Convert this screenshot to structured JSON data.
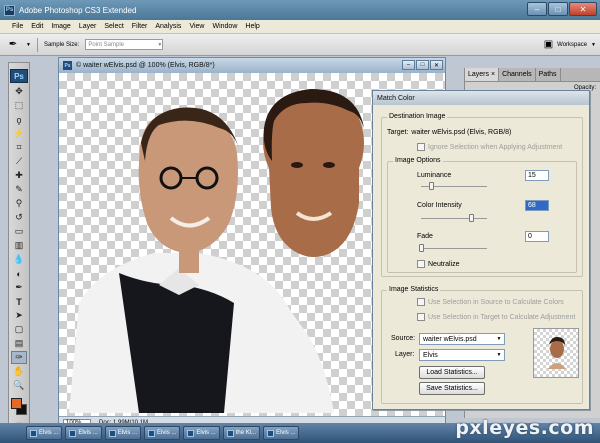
{
  "app": {
    "title": "Adobe Photoshop CS3 Extended",
    "logo": "Ps"
  },
  "menu": {
    "items": [
      "File",
      "Edit",
      "Image",
      "Layer",
      "Select",
      "Filter",
      "Analysis",
      "View",
      "Window",
      "Help"
    ]
  },
  "options_bar": {
    "sample_size_label": "Sample Size:",
    "sample_size_value": "Point Sample",
    "workspace_label": "Workspace"
  },
  "document": {
    "title": "© waiter wElvis.psd @ 100% (Elvis, RGB/8*)",
    "zoom": "100%",
    "doc_size": "Doc: 1.99M/10.1M"
  },
  "layers_panel": {
    "tabs": [
      "Layers",
      "Channels",
      "Paths"
    ],
    "opacity_label": "Opacity:"
  },
  "dialog": {
    "title": "Match Color",
    "destination": {
      "group_label": "Destination Image",
      "target_label": "Target:",
      "target_value": "waiter wElvis.psd (Elvis, RGB/8)",
      "ignore_selection": "Ignore Selection when Applying Adjustment"
    },
    "image_options": {
      "group_label": "Image Options",
      "luminance_label": "Luminance",
      "luminance_value": "15",
      "color_intensity_label": "Color Intensity",
      "color_intensity_value": "68",
      "fade_label": "Fade",
      "fade_value": "0",
      "neutralize": "Neutralize"
    },
    "statistics": {
      "group_label": "Image Statistics",
      "use_source": "Use Selection in Source to Calculate Colors",
      "use_target": "Use Selection in Target to Calculate Adjustment",
      "source_label": "Source:",
      "source_value": "waiter wElvis.psd",
      "layer_label": "Layer:",
      "layer_value": "Elvis",
      "load_button": "Load Statistics...",
      "save_button": "Save Statistics..."
    }
  },
  "taskbar": {
    "tasks": [
      "Elvis ...",
      "Elvis ...",
      "Elvis ...",
      "Elvis ...",
      "Elvis ...",
      "the Ki...",
      "Elvis ..."
    ]
  },
  "watermark": "pxleyes.com",
  "colors": {
    "foreground": "#e06a26",
    "background": "#111111"
  }
}
